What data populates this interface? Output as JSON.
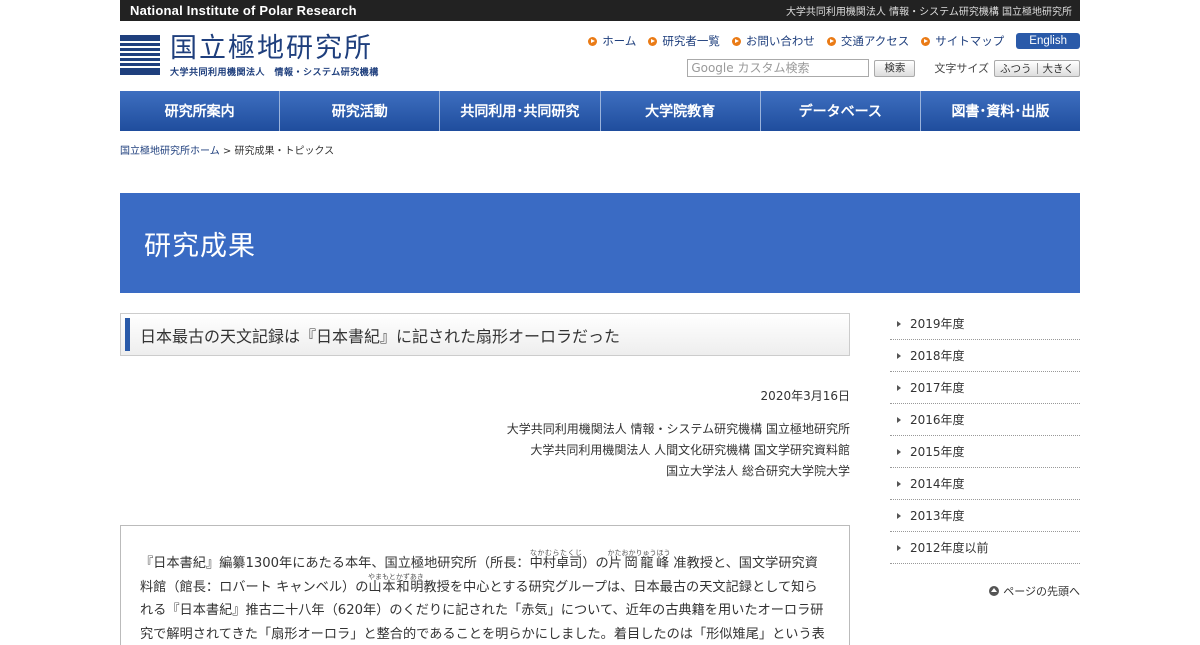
{
  "topbar": {
    "english_name": "National Institute of Polar Research",
    "japanese_affiliation": "大学共同利用機関法人 情報・システム研究機構 国立極地研究所"
  },
  "logo": {
    "main": "国立極地研究所",
    "sub": "大学共同利用機関法人　情報・システム研究機構"
  },
  "util_links": [
    "ホーム",
    "研究者一覧",
    "お問い合わせ",
    "交通アクセス",
    "サイトマップ"
  ],
  "english_button": "English",
  "search": {
    "placeholder": "Google カスタム検索",
    "button": "検索"
  },
  "font_size": {
    "label": "文字サイズ",
    "normal": "ふつう",
    "large": "大きく"
  },
  "gnav": [
    "研究所案内",
    "研究活動",
    "共同利用･共同研究",
    "大学院教育",
    "データベース",
    "図書･資料･出版"
  ],
  "breadcrumb": {
    "home": "国立極地研究所ホーム",
    "separator": ">",
    "current": "研究成果・トピックス"
  },
  "hero_title": "研究成果",
  "article": {
    "title": "日本最古の天文記録は『日本書紀』に記された扇形オーロラだった",
    "date": "2020年3月16日",
    "orgs": [
      "大学共同利用機関法人 情報・システム研究機構 国立極地研究所",
      "大学共同利用機関法人 人間文化研究機構 国文学研究資料館",
      "国立大学法人 総合研究大学院大学"
    ],
    "body": {
      "p1a": "『日本書紀』編纂1300年にあたる本年、国立極地研究所（所長：",
      "name1": "中村卓司",
      "name1_ruby": "なかむらたくじ",
      "p1b": "）の",
      "name2": "片岡龍峰",
      "name2_ruby": "かたおかりゅうほう",
      "p1c": " 准教授と、国文学研究資料館（館長：ロバート キャンベル）の",
      "name3": "山本和明",
      "name3_ruby": "やまもとかずあき",
      "p1d": "教授を中心とする研究グループは、日本最古の天文記録として知られる『日本書紀』推古二十八年（620年）のくだりに記された「赤気」について、近年の古典籍を用いたオーロラ研究で解明されてきた「扇形オーロラ」と整合的であることを明らかにしました。着目したのは「形似雉尾」という表現で"
    }
  },
  "sidebar": [
    "2019年度",
    "2018年度",
    "2017年度",
    "2016年度",
    "2015年度",
    "2014年度",
    "2013年度",
    "2012年度以前"
  ],
  "pagetop": "ページの先頭へ"
}
